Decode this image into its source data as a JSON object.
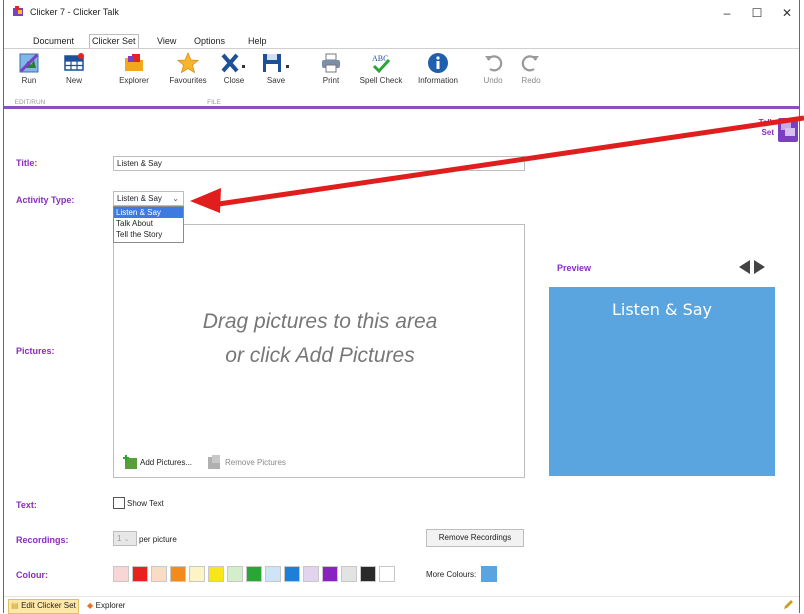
{
  "window": {
    "title": "Clicker 7 - Clicker Talk",
    "minimize": "–",
    "maximize": "☐",
    "close": "✕"
  },
  "menu": {
    "items": [
      "Document",
      "Clicker Set",
      "View",
      "Options",
      "Help"
    ],
    "active": "Clicker Set"
  },
  "ribbon": {
    "buttons": [
      "Run",
      "New",
      "Explorer",
      "Favourites",
      "Close",
      "Save",
      "Print",
      "Spell Check",
      "Information",
      "Undo",
      "Redo"
    ],
    "group_edit_run": "EDIT/RUN",
    "group_file": "FILE"
  },
  "talk_set_label": {
    "line1": "Talk",
    "line2": "Set"
  },
  "form": {
    "title_label": "Title:",
    "title_value": "Listen & Say",
    "activity_label": "Activity Type:",
    "activity_value": "Listen & Say",
    "activity_options": [
      "Listen & Say",
      "Talk About",
      "Tell the Story"
    ],
    "pictures_label": "Pictures:",
    "drop_line1": "Drag pictures to this area",
    "drop_line2": "or click Add Pictures",
    "add_pictures": "Add Pictures...",
    "remove_pictures": "Remove Pictures",
    "text_label": "Text:",
    "show_text": "Show Text",
    "recordings_label": "Recordings:",
    "recordings_value": "1",
    "per_picture": "per picture",
    "remove_recordings": "Remove Recordings",
    "colour_label": "Colour:",
    "more_colours": "More Colours:"
  },
  "preview": {
    "label": "Preview",
    "text": "Listen & Say",
    "color": "#5aa5e0"
  },
  "colours": [
    "#f9d6d6",
    "#e8211f",
    "#f8dcc4",
    "#f28a1c",
    "#fdf4c6",
    "#f8e61b",
    "#d4eecc",
    "#2aa634",
    "#cfe4f6",
    "#1e7fd8",
    "#e2d4ef",
    "#8a22c1",
    "#e3e3e3",
    "#2a2a2a",
    "#ffffff"
  ],
  "more_colour_swatch": "#5aa5e0",
  "status": {
    "edit_set": "Edit Clicker Set",
    "explorer": "Explorer"
  }
}
